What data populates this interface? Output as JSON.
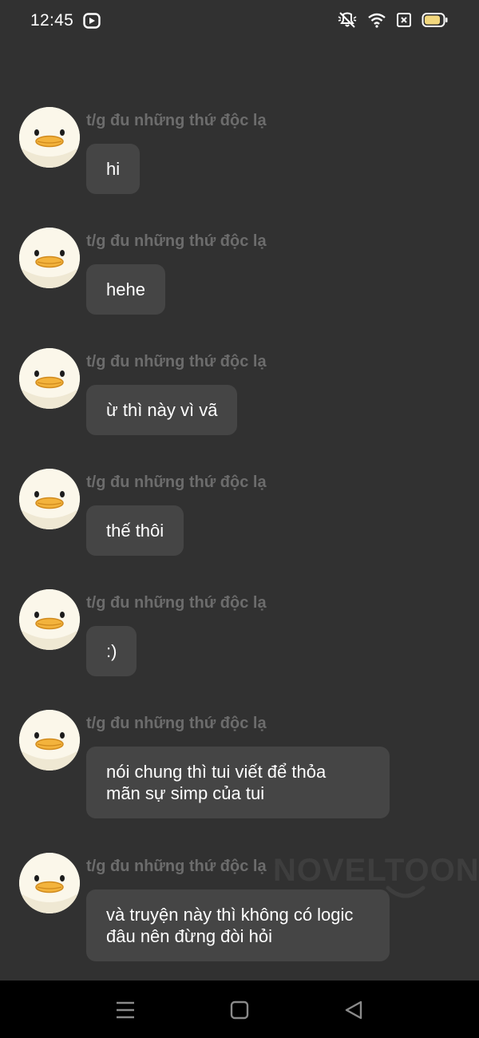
{
  "status_bar": {
    "time": "12:45",
    "app_icon": "video-play-icon",
    "icons": [
      "mute-icon",
      "wifi-icon",
      "sim-x-icon",
      "battery-icon"
    ],
    "battery_color": "#f2d77d"
  },
  "messages": [
    {
      "sender": "t/g đu những thứ độc lạ",
      "text": "hi"
    },
    {
      "sender": "t/g đu những thứ độc lạ",
      "text": "hehe"
    },
    {
      "sender": "t/g đu những thứ độc lạ",
      "text": "ừ thì này vì vã"
    },
    {
      "sender": "t/g đu những thứ độc lạ",
      "text": "thế thôi"
    },
    {
      "sender": "t/g đu những thứ độc lạ",
      "text": ":)"
    },
    {
      "sender": "t/g đu những thứ độc lạ",
      "text_lines": [
        "nói chung thì tui viết để thỏa",
        "mãn sự simp của tui"
      ]
    },
    {
      "sender": "t/g đu những thứ độc lạ",
      "text_lines": [
        "và truyện này thì không có logic",
        "đâu nên đừng đòi hỏi"
      ]
    }
  ],
  "watermark": "NOVELTOON",
  "nav_bar": {
    "buttons": [
      "menu-icon",
      "home-square-icon",
      "back-triangle-icon"
    ]
  },
  "colors": {
    "background": "#313131",
    "bubble": "#454545",
    "sender_text": "#6c6c6c",
    "avatar_bg": "#fbf7ea",
    "beak": "#f3b33c"
  }
}
